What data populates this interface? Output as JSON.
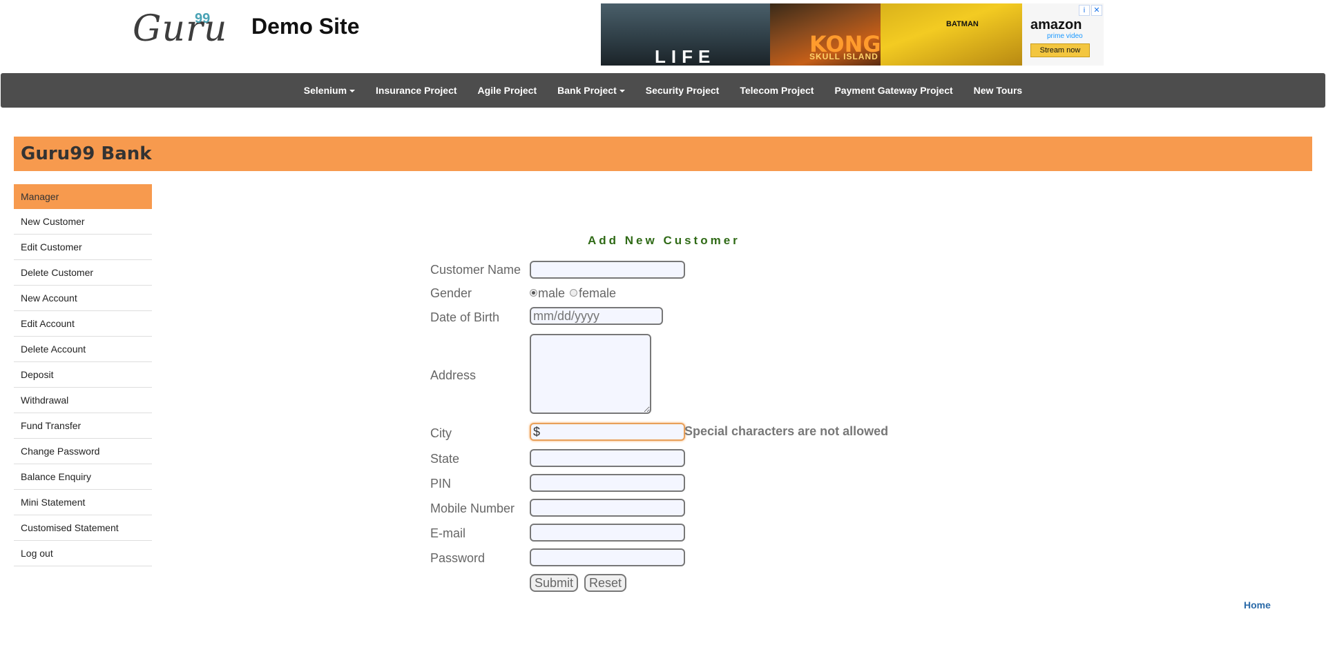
{
  "header": {
    "logo_text": "Guru",
    "logo_sup": "99",
    "site_title": "Demo Site"
  },
  "ad": {
    "panels": [
      "LIFE",
      "KONG",
      "SKULL ISLAND",
      "BATMAN"
    ],
    "brand": "amazon",
    "brand_sub": "prime video",
    "cta": "Stream now",
    "icons": [
      "info-icon",
      "close-icon"
    ]
  },
  "nav": {
    "items": [
      {
        "label": "Selenium",
        "dropdown": true
      },
      {
        "label": "Insurance Project",
        "dropdown": false
      },
      {
        "label": "Agile Project",
        "dropdown": false
      },
      {
        "label": "Bank Project",
        "dropdown": true
      },
      {
        "label": "Security Project",
        "dropdown": false
      },
      {
        "label": "Telecom Project",
        "dropdown": false
      },
      {
        "label": "Payment Gateway Project",
        "dropdown": false
      },
      {
        "label": "New Tours",
        "dropdown": false
      }
    ]
  },
  "bank": {
    "title": "Guru99 Bank"
  },
  "sidebar": {
    "items": [
      {
        "label": "Manager",
        "active": true
      },
      {
        "label": "New Customer"
      },
      {
        "label": "Edit Customer"
      },
      {
        "label": "Delete Customer"
      },
      {
        "label": "New Account"
      },
      {
        "label": "Edit Account"
      },
      {
        "label": "Delete Account"
      },
      {
        "label": "Deposit"
      },
      {
        "label": "Withdrawal"
      },
      {
        "label": "Fund Transfer"
      },
      {
        "label": "Change Password"
      },
      {
        "label": "Balance Enquiry"
      },
      {
        "label": "Mini Statement"
      },
      {
        "label": "Customised Statement"
      },
      {
        "label": "Log out"
      }
    ]
  },
  "form": {
    "title": "Add New Customer",
    "labels": {
      "customer_name": "Customer Name",
      "gender": "Gender",
      "dob": "Date of Birth",
      "address": "Address",
      "city": "City",
      "state": "State",
      "pin": "PIN",
      "mobile": "Mobile Number",
      "email": "E-mail",
      "password": "Password"
    },
    "gender_options": {
      "male": "male",
      "female": "female",
      "selected": "male"
    },
    "values": {
      "customer_name": "",
      "dob_placeholder": "mm/dd/yyyy",
      "address": "",
      "city": "$",
      "state": "",
      "pin": "",
      "mobile": "",
      "email": "",
      "password": ""
    },
    "city_error": "Special characters are not allowed",
    "submit_label": "Submit",
    "reset_label": "Reset"
  },
  "footer": {
    "home_label": "Home"
  }
}
